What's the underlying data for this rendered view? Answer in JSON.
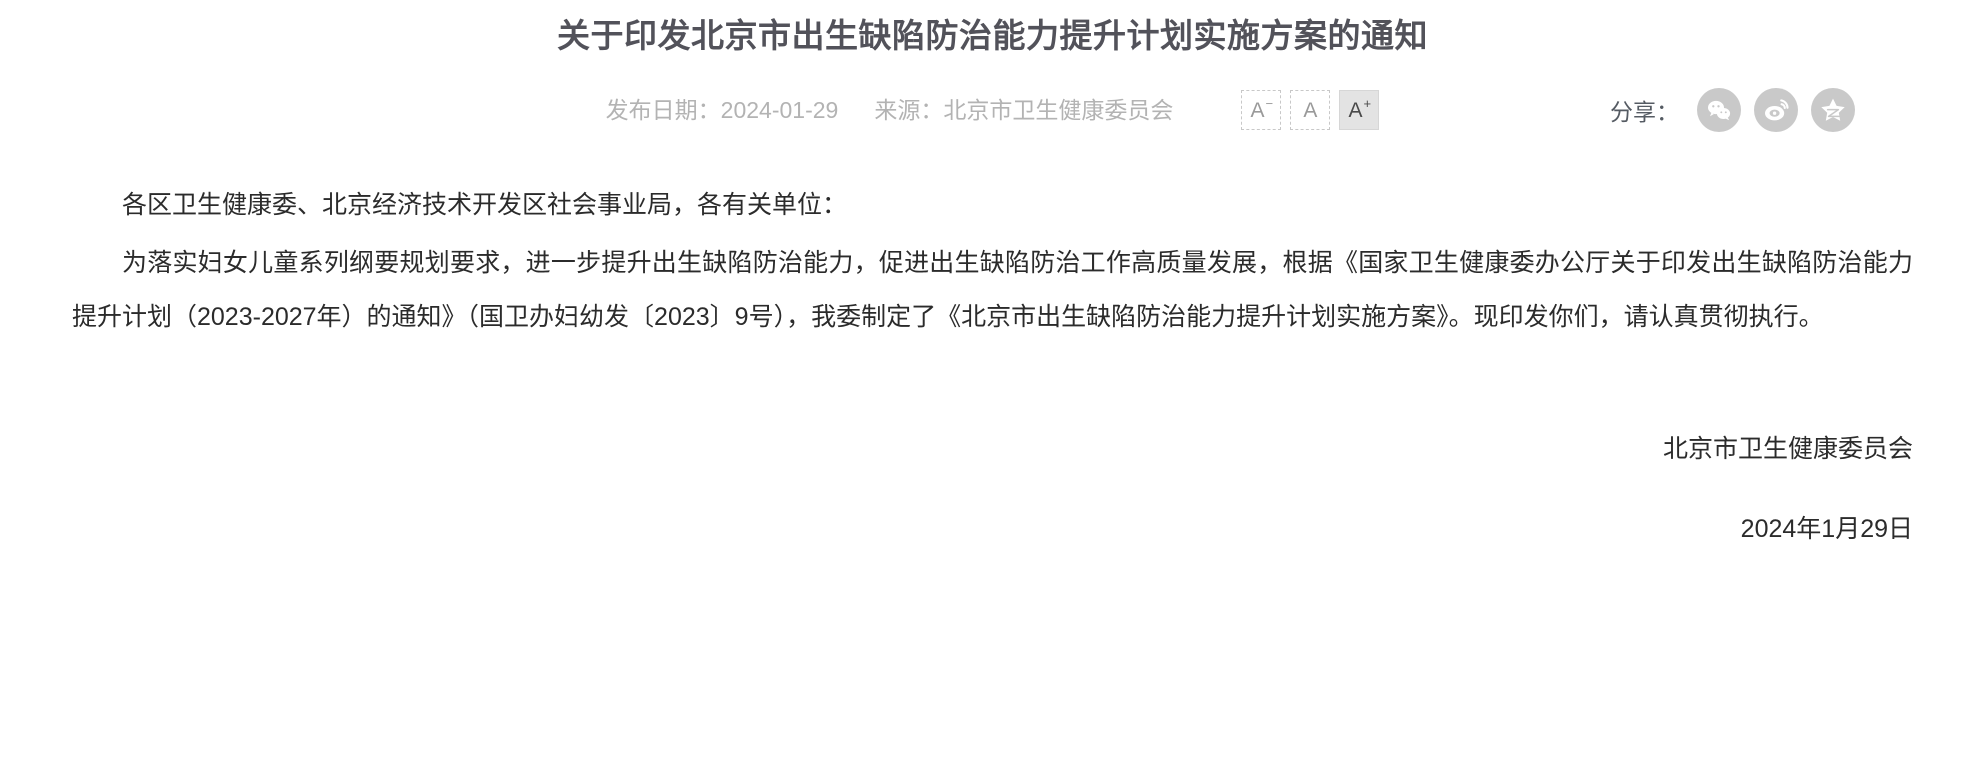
{
  "article": {
    "title": "关于印发北京市出生缺陷防治能力提升计划实施方案的通知",
    "meta": {
      "publish_date_label": "发布日期：2024-01-29",
      "source_label": "来源：北京市卫生健康委员会"
    },
    "fontsize_controls": {
      "decrease": {
        "glyph": "A",
        "sup": "−",
        "state": "inactive"
      },
      "normal": {
        "glyph": "A",
        "sup": "",
        "state": "inactive"
      },
      "increase": {
        "glyph": "A",
        "sup": "+",
        "state": "active"
      }
    },
    "share": {
      "label": "分享：",
      "items": [
        {
          "name": "wechat-share-icon",
          "color": "#c9c9c9"
        },
        {
          "name": "weibo-share-icon",
          "color": "#c9c9c9"
        },
        {
          "name": "qzone-share-icon",
          "color": "#c9c9c9"
        }
      ]
    },
    "body": {
      "salutation": "各区卫生健康委、北京经济技术开发区社会事业局，各有关单位：",
      "paragraph": "为落实妇女儿童系列纲要规划要求，进一步提升出生缺陷防治能力，促进出生缺陷防治工作高质量发展，根据《国家卫生健康委办公厅关于印发出生缺陷防治能力提升计划（2023-2027年）的通知》（国卫办妇幼发〔2023〕9号），我委制定了《北京市出生缺陷防治能力提升计划实施方案》。现印发你们，请认真贯彻执行。"
    },
    "signature": {
      "issuer": "北京市卫生健康委员会",
      "date": "2024年1月29日"
    },
    "colors": {
      "title": "#52525a",
      "meta": "#b3b3b3",
      "body": "#2b2b2b",
      "share_circle": "#c9c9c9",
      "active_button_bg": "#e3e3e3"
    }
  }
}
